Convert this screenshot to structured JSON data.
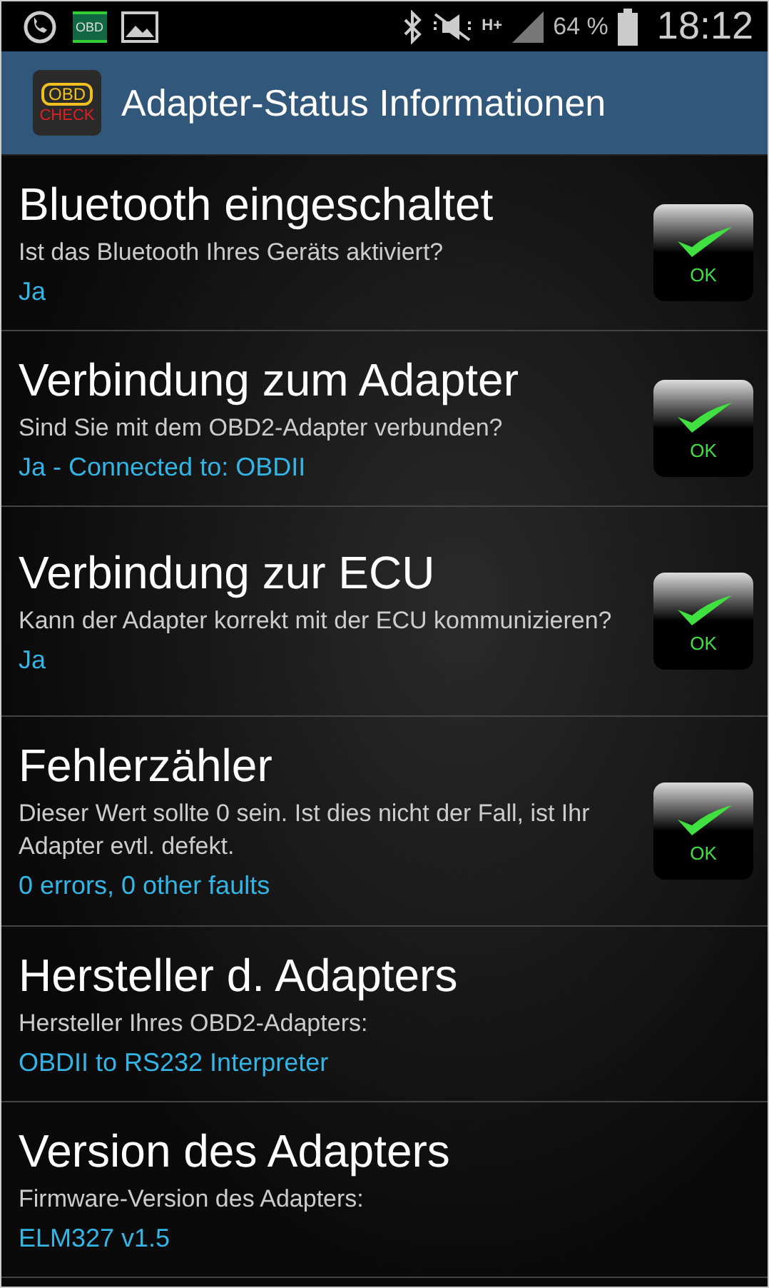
{
  "status_bar": {
    "network": "H+",
    "battery": "64 %",
    "time": "18:12",
    "obd_icon_label": "OBD"
  },
  "header": {
    "icon_top": "OBD",
    "icon_bottom": "CHECK",
    "title": "Adapter-Status Informationen"
  },
  "items": [
    {
      "kind": "check",
      "title": "Bluetooth eingeschaltet",
      "description": "Ist das Bluetooth Ihres Geräts aktiviert?",
      "value": "Ja",
      "status_label": "OK"
    },
    {
      "kind": "check",
      "title": "Verbindung zum Adapter",
      "description": "Sind Sie mit dem OBD2-Adapter verbunden?",
      "value": "Ja - Connected to: OBDII",
      "status_label": "OK"
    },
    {
      "kind": "check",
      "title": "Verbindung zur ECU",
      "description": "Kann der Adapter korrekt mit der ECU kommunizieren?",
      "value": "Ja",
      "status_label": "OK"
    },
    {
      "kind": "check",
      "title": "Fehlerzähler",
      "description": "Dieser Wert sollte 0 sein. Ist dies nicht der Fall, ist Ihr Adapter evtl. defekt.",
      "value": "0 errors, 0 other faults",
      "status_label": "OK"
    },
    {
      "kind": "info",
      "title": "Hersteller d. Adapters",
      "description": "Hersteller Ihres OBD2-Adapters:",
      "value": "OBDII to RS232 Interpreter"
    },
    {
      "kind": "info",
      "title": "Version des Adapters",
      "description": "Firmware-Version des Adapters:",
      "value": "ELM327 v1.5"
    }
  ]
}
